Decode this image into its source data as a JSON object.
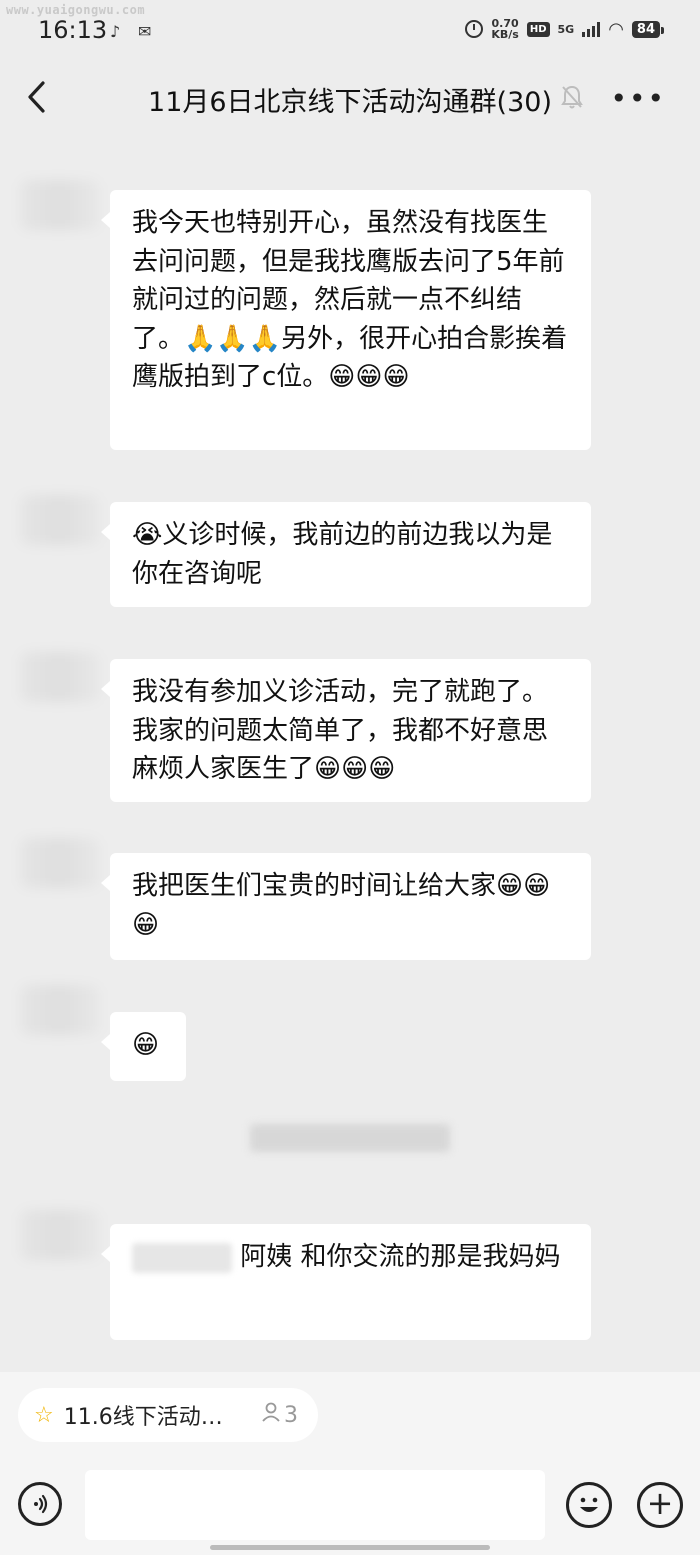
{
  "watermark": "www.yuaigongwu.com",
  "status": {
    "time": "16:13",
    "speed_value": "0.70",
    "speed_unit": "KB/s",
    "hd": "HD",
    "network": "5G",
    "battery": "84"
  },
  "header": {
    "title": "11月6日北京线下活动沟通群(30)"
  },
  "messages": [
    {
      "text": "我今天也特别开心，虽然没有找医生去问问题，但是我找鹰版去问了5年前就问过的问题，然后就一点不纠结了。🙏🙏🙏另外，很开心拍合影挨着鹰版拍到了c位。😁😁😁"
    },
    {
      "text": "😭义诊时候，我前边的前边我以为是你在咨询呢"
    },
    {
      "text": "我没有参加义诊活动，完了就跑了。我家的问题太简单了，我都不好意思麻烦人家医生了😁😁😁"
    },
    {
      "text": "我把医生们宝贵的时间让给大家😁😁😁"
    },
    {
      "text": "😁"
    },
    {
      "text": "阿姨 和你交流的那是我妈妈"
    }
  ],
  "pinned": {
    "label": "11.6线下活动…",
    "count": "3"
  }
}
